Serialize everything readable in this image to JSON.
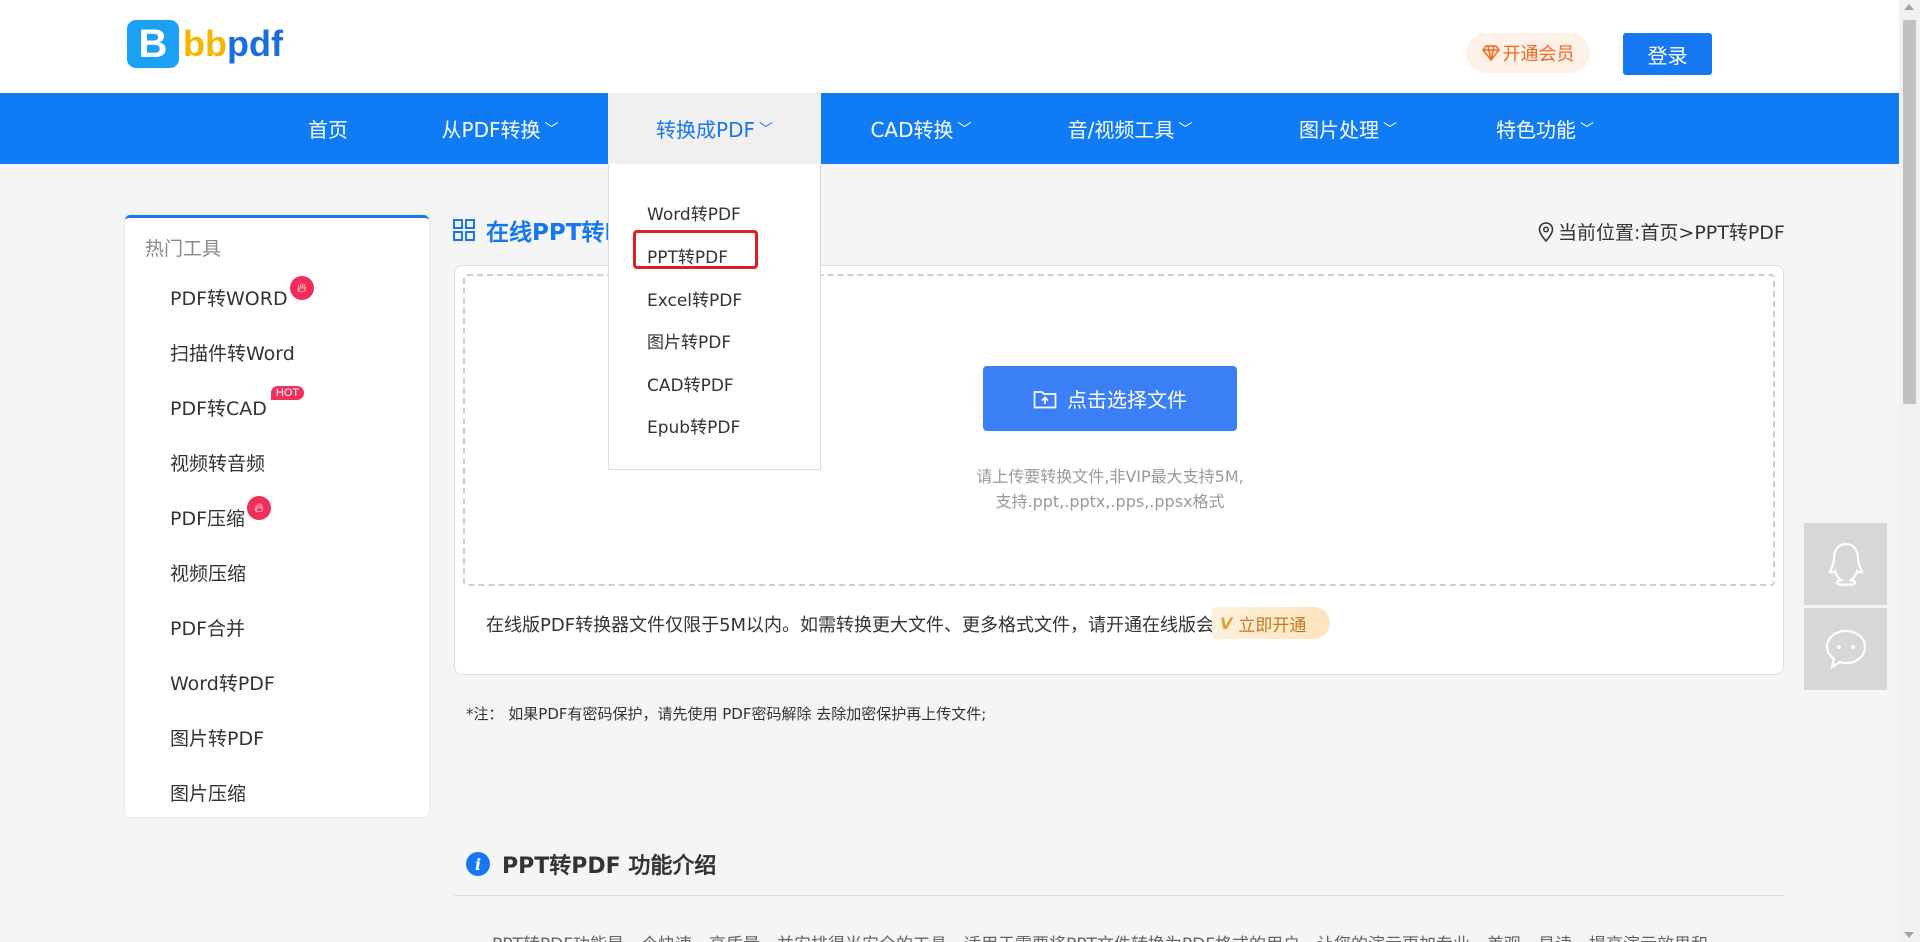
{
  "header": {
    "logo_letter": "B",
    "logo_bb": "bb",
    "logo_pdf": "pdf",
    "vip_label": "开通会员",
    "login_label": "登录"
  },
  "nav": {
    "items": [
      {
        "label": "首页"
      },
      {
        "label": "从PDF转换"
      },
      {
        "label": "转换成PDF"
      },
      {
        "label": "CAD转换"
      },
      {
        "label": "音/视频工具"
      },
      {
        "label": "图片处理"
      },
      {
        "label": "特色功能"
      }
    ],
    "dropdown": [
      "Word转PDF",
      "PPT转PDF",
      "Excel转PDF",
      "图片转PDF",
      "CAD转PDF",
      "Epub转PDF"
    ]
  },
  "sidebar": {
    "title": "热门工具",
    "items": [
      {
        "label": "PDF转WORD"
      },
      {
        "label": "扫描件转Word"
      },
      {
        "label": "PDF转CAD",
        "badge": "HOT"
      },
      {
        "label": "视频转音频"
      },
      {
        "label": "PDF压缩"
      },
      {
        "label": "视频压缩"
      },
      {
        "label": "PDF合并"
      },
      {
        "label": "Word转PDF"
      },
      {
        "label": "图片转PDF"
      },
      {
        "label": "图片压缩"
      }
    ]
  },
  "main": {
    "title": "在线PPT转PDF",
    "location": "当前位置:首页>PPT转PDF",
    "select_button": "点击选择文件",
    "hint_line1": "请上传要转换文件,非VIP最大支持5M,",
    "hint_line2": "支持.ppt,.pptx,.pps,.ppsx格式",
    "limit_text": "在线版PDF转换器文件仅限于5M以内。如需转换更大文件、更多格式文件，请开通在线版会员",
    "open_button": "立即开通",
    "vip_mark": "V",
    "note": "*注： 如果PDF有密码保护，请先使用 PDF密码解除 去除加密保护再上传文件;",
    "intro_title": "PPT转PDF 功能介绍",
    "intro_text": "PPT转PDF功能是一个快速、高质量、并安排得当安全的工具，适用于需要将PPT文件转换为PDF格式的用户，让您的演示更加专业、美观、易读，提高演示效果和"
  },
  "colors": {
    "nav_bg": "#0f7cf6",
    "accent": "#1677f2",
    "highlight_border": "#e02020"
  }
}
